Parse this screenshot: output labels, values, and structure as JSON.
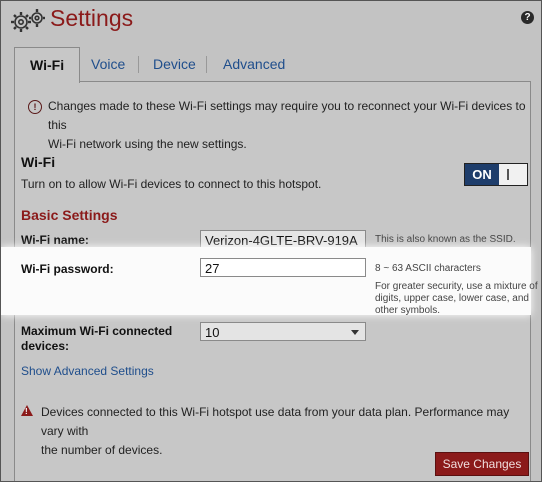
{
  "header": {
    "title": "Settings",
    "help_glyph": "?"
  },
  "tabs": [
    {
      "label": "Wi-Fi",
      "active": true
    },
    {
      "label": "Voice"
    },
    {
      "label": "Device"
    },
    {
      "label": "Advanced"
    }
  ],
  "notice": {
    "line1": "Changes made to these Wi-Fi settings may require you to reconnect your Wi-Fi devices to this",
    "line2": "Wi-Fi network using the new settings."
  },
  "wifi": {
    "heading": "Wi-Fi",
    "description": "Turn on to allow Wi-Fi devices to connect to this hotspot.",
    "toggle_label": "ON"
  },
  "basic": {
    "heading": "Basic Settings",
    "name_label": "Wi-Fi name:",
    "name_value": "Verizon-4GLTE-BRV-919A",
    "name_hint": "This is also known as the SSID.",
    "password_label": "Wi-Fi password:",
    "password_value": "27",
    "password_hint": "8 ~ 63 ASCII characters",
    "security_hint_1": "For greater security, use a mixture of",
    "security_hint_2": "digits, upper case, lower case, and",
    "security_hint_3": "other symbols.",
    "max_label_1": "Maximum Wi-Fi connected",
    "max_label_2": "devices:",
    "max_value": "10"
  },
  "advanced_link": "Show Advanced Settings",
  "warning": {
    "line1": "Devices connected to this Wi-Fi hotspot use data from your data plan. Performance may vary with",
    "line2": "the number of devices."
  },
  "save_label": "Save Changes",
  "colors": {
    "brand": "#8b1a1a",
    "link": "#1f4e8c",
    "toggle_on": "#1e3d6b"
  }
}
